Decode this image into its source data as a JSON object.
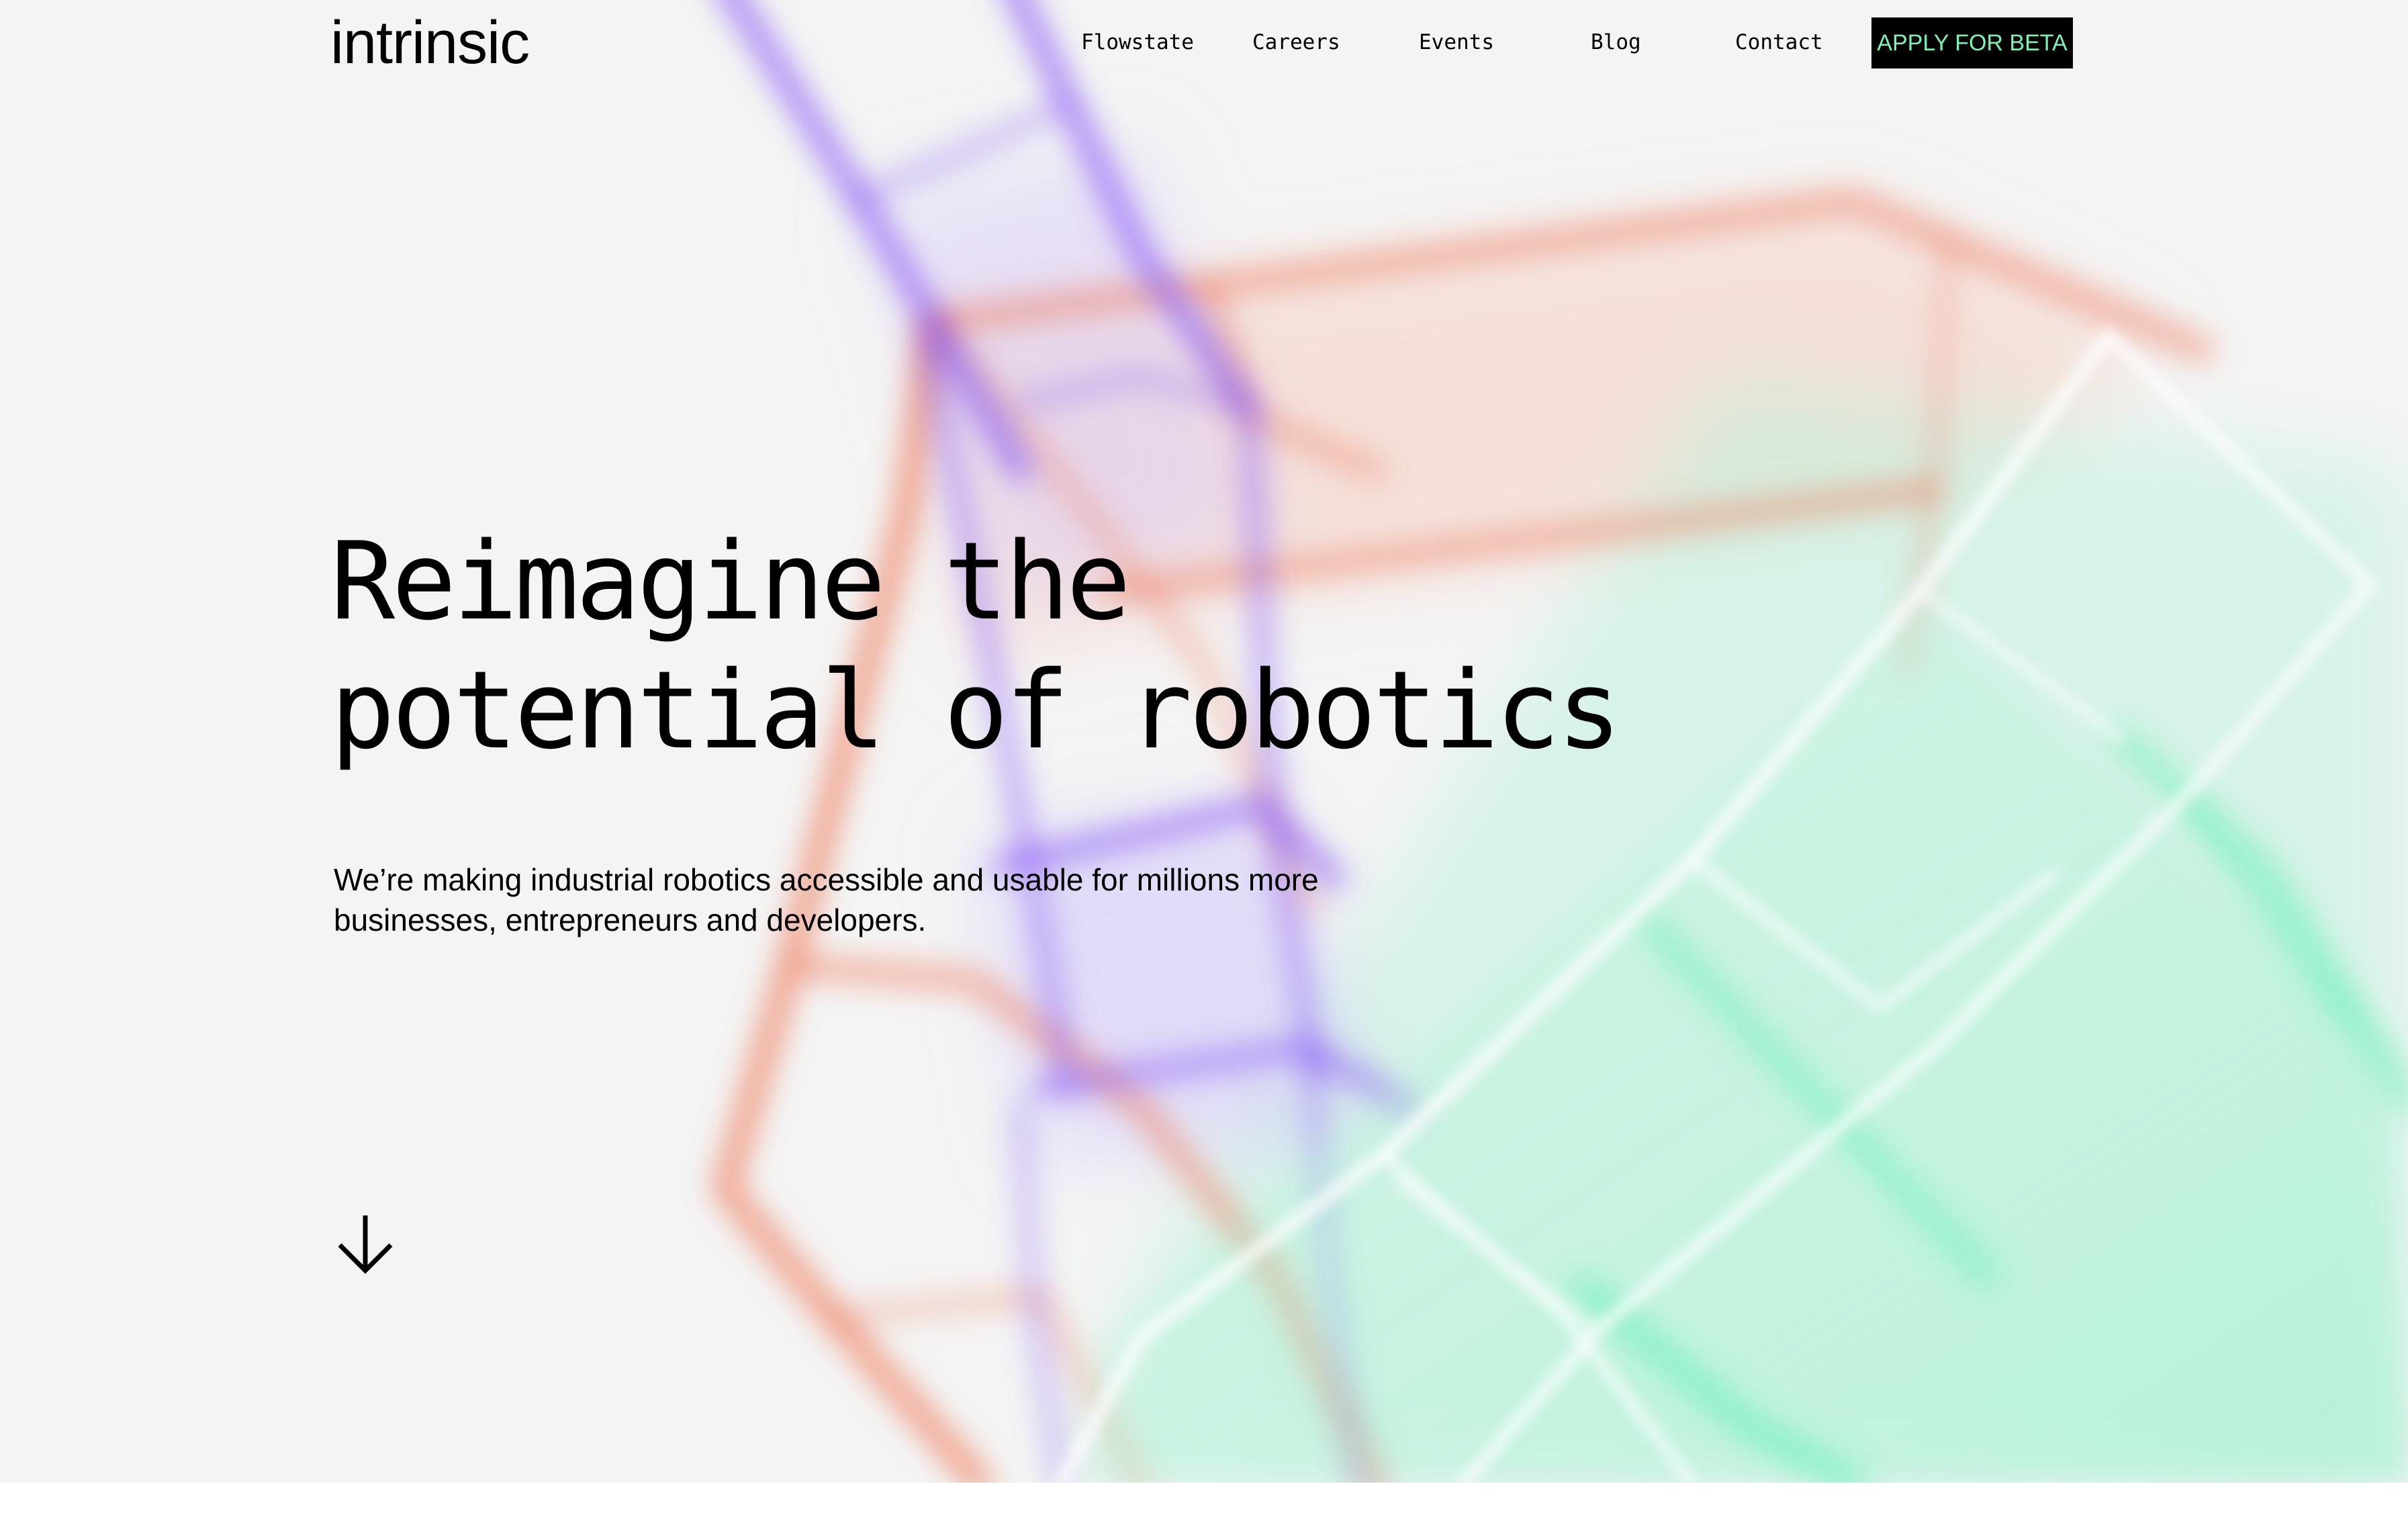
{
  "header": {
    "logo_text": "intrinsic",
    "nav": [
      {
        "label": "Flowstate"
      },
      {
        "label": "Careers"
      },
      {
        "label": "Events"
      },
      {
        "label": "Blog"
      },
      {
        "label": "Contact"
      }
    ],
    "cta_label": "APPLY FOR BETA"
  },
  "hero": {
    "headline_line1": "Reimagine the",
    "headline_line2": "potential of robotics",
    "subtext_line1": "We’re making industrial robotics accessible and usable for millions more",
    "subtext_line2": "businesses, entrepreneurs and developers.",
    "scroll_icon": "arrow-down-icon"
  },
  "colors": {
    "background": "#f4f4f4",
    "text": "#000000",
    "cta_background": "#000000",
    "cta_text": "#7df2b6",
    "art_purple": "#8b5cf6",
    "art_orange": "#f07a57",
    "art_green": "#6ff0bd"
  }
}
